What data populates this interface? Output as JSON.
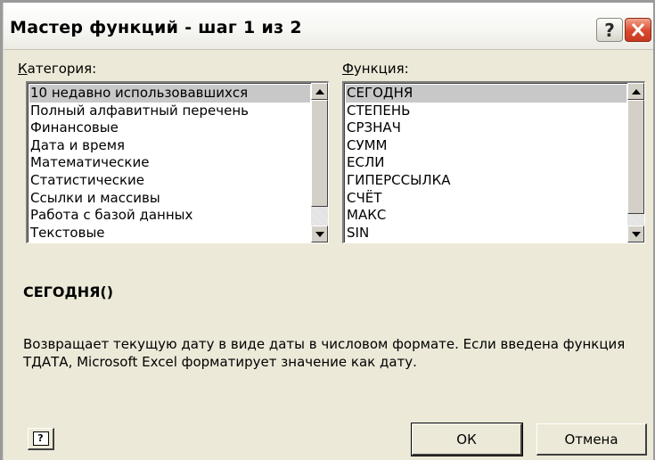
{
  "window": {
    "title": "Мастер функций - шаг 1 из 2",
    "help_glyph": "?"
  },
  "category": {
    "label": "Категория:",
    "accel": "К",
    "label_rest": "атегория:",
    "items": [
      "10 недавно использовавшихся",
      "Полный алфавитный перечень",
      "Финансовые",
      "Дата и время",
      "Математические",
      "Статистические",
      "Ссылки и массивы",
      "Работа с базой данных",
      "Текстовые"
    ],
    "selected_index": 0
  },
  "function": {
    "label": "Функция:",
    "accel": "Ф",
    "label_rest": "ункция:",
    "items": [
      "СЕГОДНЯ",
      "СТЕПЕНЬ",
      "СРЗНАЧ",
      "СУММ",
      "ЕСЛИ",
      "ГИПЕРССЫЛКА",
      "СЧЁТ",
      "МАКС",
      "SIN"
    ],
    "selected_index": 0
  },
  "syntax": "СЕГОДНЯ()",
  "description": "Возвращает текущую дату в виде даты в числовом формате. Если введена функция ТДАТА, Microsoft Excel форматирует значение как дату.",
  "buttons": {
    "help_icon": "?",
    "ok": "ОК",
    "cancel": "Отмена"
  },
  "colors": {
    "dialog_bg": "#ece9d8",
    "selection_bg": "#c8c8c8",
    "close_red": "#d9482e"
  },
  "icons": [
    "help-icon",
    "close-icon",
    "scroll-up-icon",
    "scroll-down-icon",
    "help-book-icon"
  ]
}
